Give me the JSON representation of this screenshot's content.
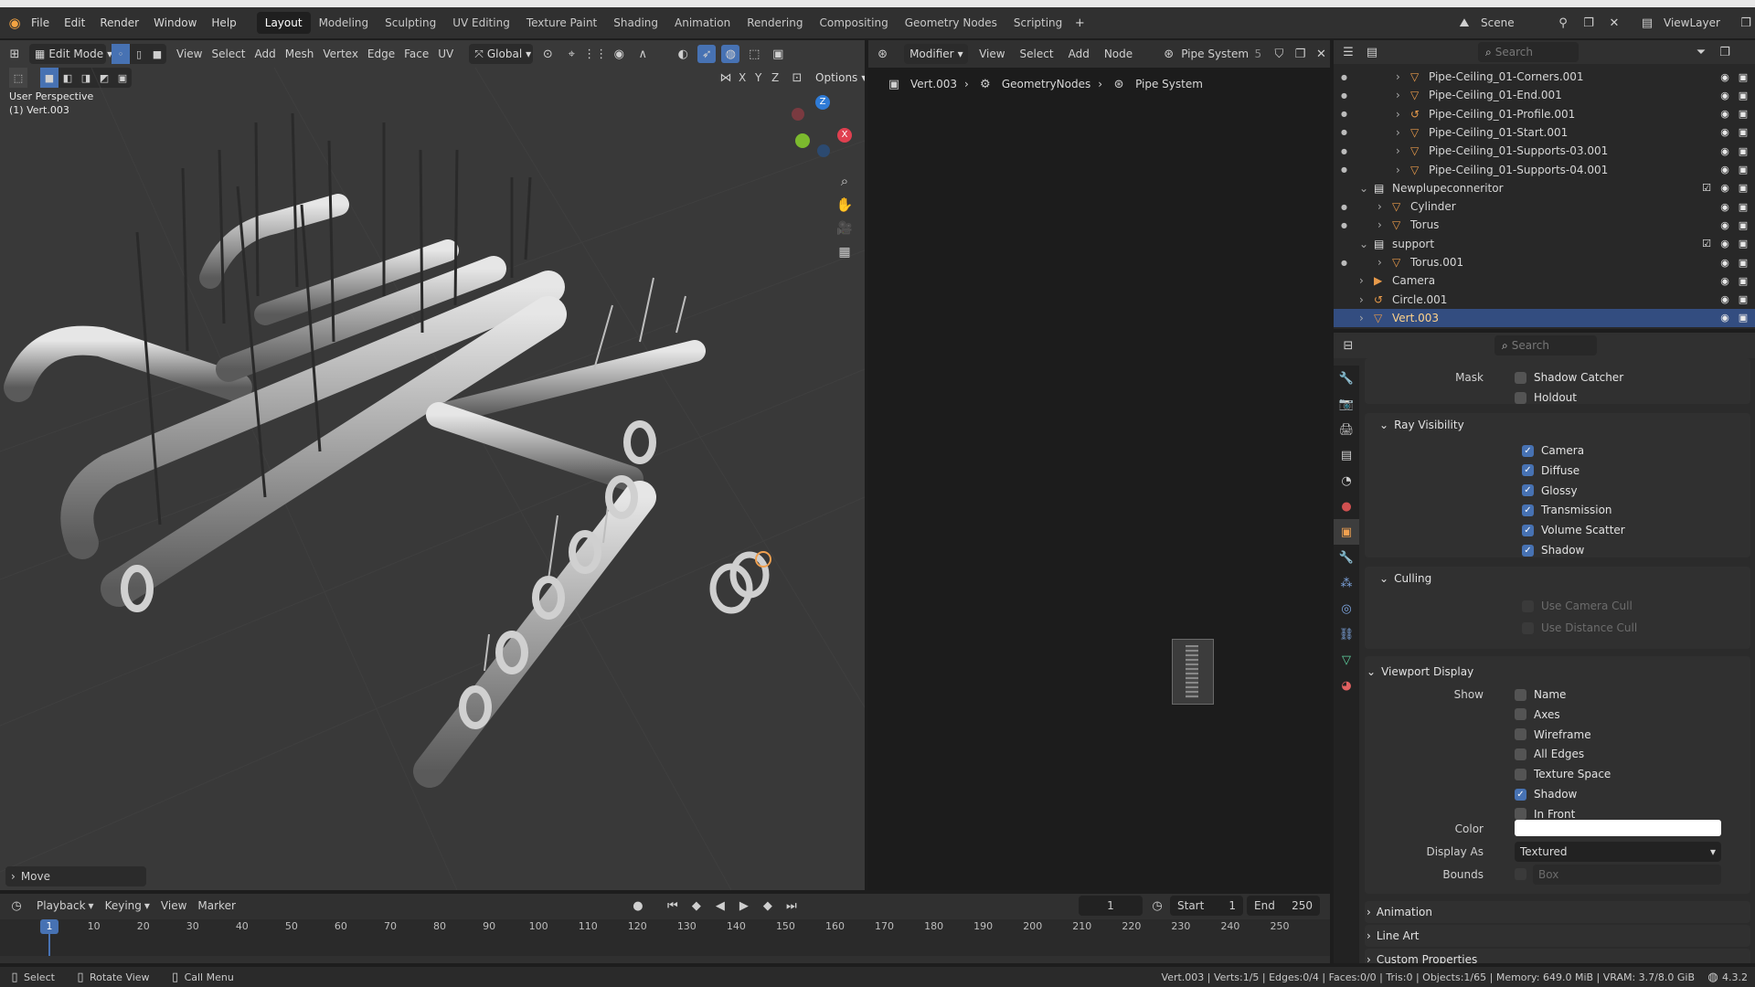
{
  "window": {
    "title": ""
  },
  "menubar": {
    "items": [
      "File",
      "Edit",
      "Render",
      "Window",
      "Help"
    ]
  },
  "workspaces": {
    "tabs": [
      "Layout",
      "Modeling",
      "Sculpting",
      "UV Editing",
      "Texture Paint",
      "Shading",
      "Animation",
      "Rendering",
      "Compositing",
      "Geometry Nodes",
      "Scripting"
    ],
    "active": "Layout"
  },
  "scene": {
    "label": "Scene",
    "viewlayer": "ViewLayer"
  },
  "viewport": {
    "mode": "Edit Mode",
    "menu": [
      "View",
      "Select",
      "Add",
      "Mesh",
      "Vertex",
      "Edge",
      "Face",
      "UV"
    ],
    "orientation": "Global",
    "overlay_text": "User Perspective",
    "object_text": "(1) Vert.003",
    "axes": [
      "X",
      "Y",
      "Z"
    ],
    "options_label": "Options",
    "last_op": "Move"
  },
  "node_editor": {
    "type_label": "Modifier",
    "menu": [
      "View",
      "Select",
      "Add",
      "Node"
    ],
    "tree_name": "Pipe System",
    "users": "5",
    "breadcrumb": [
      "Vert.003",
      "GeometryNodes",
      "Pipe System"
    ]
  },
  "outliner": {
    "search_placeholder": "Search",
    "rows": [
      {
        "name": "Pipe-Ceiling_01-Corners.001",
        "indent": 3,
        "type": "mesh",
        "dot": true
      },
      {
        "name": "Pipe-Ceiling_01-End.001",
        "indent": 3,
        "type": "mesh",
        "dot": true
      },
      {
        "name": "Pipe-Ceiling_01-Profile.001",
        "indent": 3,
        "type": "curve",
        "dot": true
      },
      {
        "name": "Pipe-Ceiling_01-Start.001",
        "indent": 3,
        "type": "mesh",
        "dot": true
      },
      {
        "name": "Pipe-Ceiling_01-Supports-03.001",
        "indent": 3,
        "type": "mesh",
        "dot": true
      },
      {
        "name": "Pipe-Ceiling_01-Supports-04.001",
        "indent": 3,
        "type": "mesh",
        "dot": true
      },
      {
        "name": "Newplupeconneritor",
        "indent": 1,
        "type": "collection",
        "dot": false
      },
      {
        "name": "Cylinder",
        "indent": 2,
        "type": "mesh",
        "dot": true
      },
      {
        "name": "Torus",
        "indent": 2,
        "type": "mesh",
        "dot": true
      },
      {
        "name": "support",
        "indent": 1,
        "type": "collection",
        "dot": false
      },
      {
        "name": "Torus.001",
        "indent": 2,
        "type": "mesh",
        "dot": true
      },
      {
        "name": "Camera",
        "indent": 1,
        "type": "camera",
        "dot": false
      },
      {
        "name": "Circle.001",
        "indent": 1,
        "type": "curve",
        "dot": false
      },
      {
        "name": "Vert.003",
        "indent": 1,
        "type": "mesh",
        "dot": false,
        "selected": true
      }
    ]
  },
  "properties": {
    "search_placeholder": "Search",
    "mask_label": "Mask",
    "mask_items": [
      {
        "label": "Shadow Catcher",
        "checked": false
      },
      {
        "label": "Holdout",
        "checked": false
      }
    ],
    "ray_visibility": {
      "title": "Ray Visibility",
      "items": [
        {
          "label": "Camera",
          "checked": true
        },
        {
          "label": "Diffuse",
          "checked": true
        },
        {
          "label": "Glossy",
          "checked": true
        },
        {
          "label": "Transmission",
          "checked": true
        },
        {
          "label": "Volume Scatter",
          "checked": true
        },
        {
          "label": "Shadow",
          "checked": true
        }
      ]
    },
    "culling": {
      "title": "Culling",
      "items": [
        {
          "label": "Use Camera Cull",
          "checked": false
        },
        {
          "label": "Use Distance Cull",
          "checked": false
        }
      ]
    },
    "viewport_display": {
      "title": "Viewport Display",
      "show_label": "Show",
      "items": [
        {
          "label": "Name",
          "checked": false
        },
        {
          "label": "Axes",
          "checked": false
        },
        {
          "label": "Wireframe",
          "checked": false
        },
        {
          "label": "All Edges",
          "checked": false
        },
        {
          "label": "Texture Space",
          "checked": false
        },
        {
          "label": "Shadow",
          "checked": true
        },
        {
          "label": "In Front",
          "checked": false
        }
      ],
      "color_label": "Color",
      "color_value": "#ffffff",
      "display_as_label": "Display As",
      "display_as_value": "Textured",
      "bounds_label": "Bounds",
      "bounds_value": "Box"
    },
    "collapsed_panels": [
      "Animation",
      "Line Art",
      "Custom Properties"
    ]
  },
  "timeline": {
    "menu": [
      "Playback",
      "Keying",
      "View",
      "Marker"
    ],
    "current_frame": "1",
    "start_label": "Start",
    "start": "1",
    "end_label": "End",
    "end": "250",
    "ticks": [
      "1",
      "10",
      "20",
      "30",
      "40",
      "50",
      "60",
      "70",
      "80",
      "90",
      "100",
      "110",
      "120",
      "130",
      "140",
      "150",
      "160",
      "170",
      "180",
      "190",
      "200",
      "210",
      "220",
      "230",
      "240",
      "250"
    ]
  },
  "statusbar": {
    "hints": [
      "Select",
      "Rotate View",
      "Call Menu"
    ],
    "stats": "Vert.003 | Verts:1/5 | Edges:0/4 | Faces:0/0 | Tris:0 | Objects:1/65 | Memory: 649.0 MiB | VRAM: 3.7/8.0 GiB",
    "version": "4.3.2"
  },
  "colors": {
    "accent": "#4772b3",
    "selection": "#334d80",
    "mesh_icon": "#e89a4a",
    "modifier_icon": "#7ea6e0",
    "data_icon": "#5fd3a0"
  }
}
